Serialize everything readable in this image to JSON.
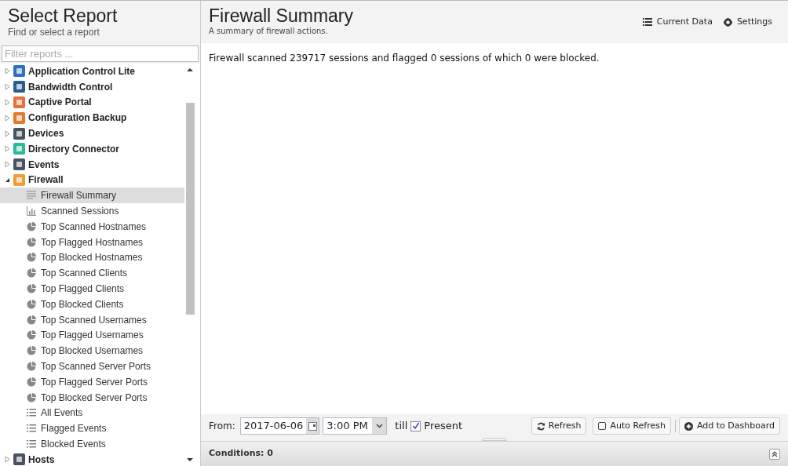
{
  "sidebar": {
    "title": "Select Report",
    "subtitle": "Find or select a report",
    "filter": {
      "placeholder": "Filter reports ..."
    },
    "items": [
      {
        "label": "Application Control Lite",
        "color": "#2f6fbf",
        "expanded": false
      },
      {
        "label": "Bandwidth Control",
        "color": "#2a5d8f",
        "expanded": false
      },
      {
        "label": "Captive Portal",
        "color": "#e8703a",
        "expanded": false
      },
      {
        "label": "Configuration Backup",
        "color": "#e07a2c",
        "expanded": false
      },
      {
        "label": "Devices",
        "color": "#4a5160",
        "expanded": false
      },
      {
        "label": "Directory Connector",
        "color": "#2bb99a",
        "expanded": false
      },
      {
        "label": "Events",
        "color": "#4a5160",
        "expanded": false
      },
      {
        "label": "Firewall",
        "color": "#f39c33",
        "expanded": true,
        "children": [
          {
            "label": "Firewall Summary",
            "kind": "text",
            "selected": true
          },
          {
            "label": "Scanned Sessions",
            "kind": "bar",
            "selected": false
          },
          {
            "label": "Top Scanned Hostnames",
            "kind": "pie",
            "selected": false
          },
          {
            "label": "Top Flagged Hostnames",
            "kind": "pie",
            "selected": false
          },
          {
            "label": "Top Blocked Hostnames",
            "kind": "pie",
            "selected": false
          },
          {
            "label": "Top Scanned Clients",
            "kind": "pie",
            "selected": false
          },
          {
            "label": "Top Flagged Clients",
            "kind": "pie",
            "selected": false
          },
          {
            "label": "Top Blocked Clients",
            "kind": "pie",
            "selected": false
          },
          {
            "label": "Top Scanned Usernames",
            "kind": "pie",
            "selected": false
          },
          {
            "label": "Top Flagged Usernames",
            "kind": "pie",
            "selected": false
          },
          {
            "label": "Top Blocked Usernames",
            "kind": "pie",
            "selected": false
          },
          {
            "label": "Top Scanned Server Ports",
            "kind": "pie",
            "selected": false
          },
          {
            "label": "Top Flagged Server Ports",
            "kind": "pie",
            "selected": false
          },
          {
            "label": "Top Blocked Server Ports",
            "kind": "pie",
            "selected": false
          },
          {
            "label": "All Events",
            "kind": "list",
            "selected": false
          },
          {
            "label": "Flagged Events",
            "kind": "list",
            "selected": false
          },
          {
            "label": "Blocked Events",
            "kind": "list",
            "selected": false
          }
        ]
      },
      {
        "label": "Hosts",
        "color": "#4a5160",
        "expanded": false
      }
    ]
  },
  "report": {
    "title": "Firewall Summary",
    "subtitle": "A summary of firewall actions.",
    "actions": [
      "Current Data",
      "Settings"
    ],
    "text": "Firewall scanned 239717 sessions and flagged 0 sessions of which 0 were blocked."
  },
  "toolbar": {
    "from_label": "From:",
    "date": "2017-06-06",
    "time": "3:00 PM",
    "till_label": "till",
    "present": {
      "label": "Present",
      "checked": true
    },
    "refresh": "Refresh",
    "auto_refresh": {
      "label": "Auto Refresh",
      "checked": false
    },
    "add": "Add to Dashboard"
  },
  "conditions": "Conditions: 0"
}
